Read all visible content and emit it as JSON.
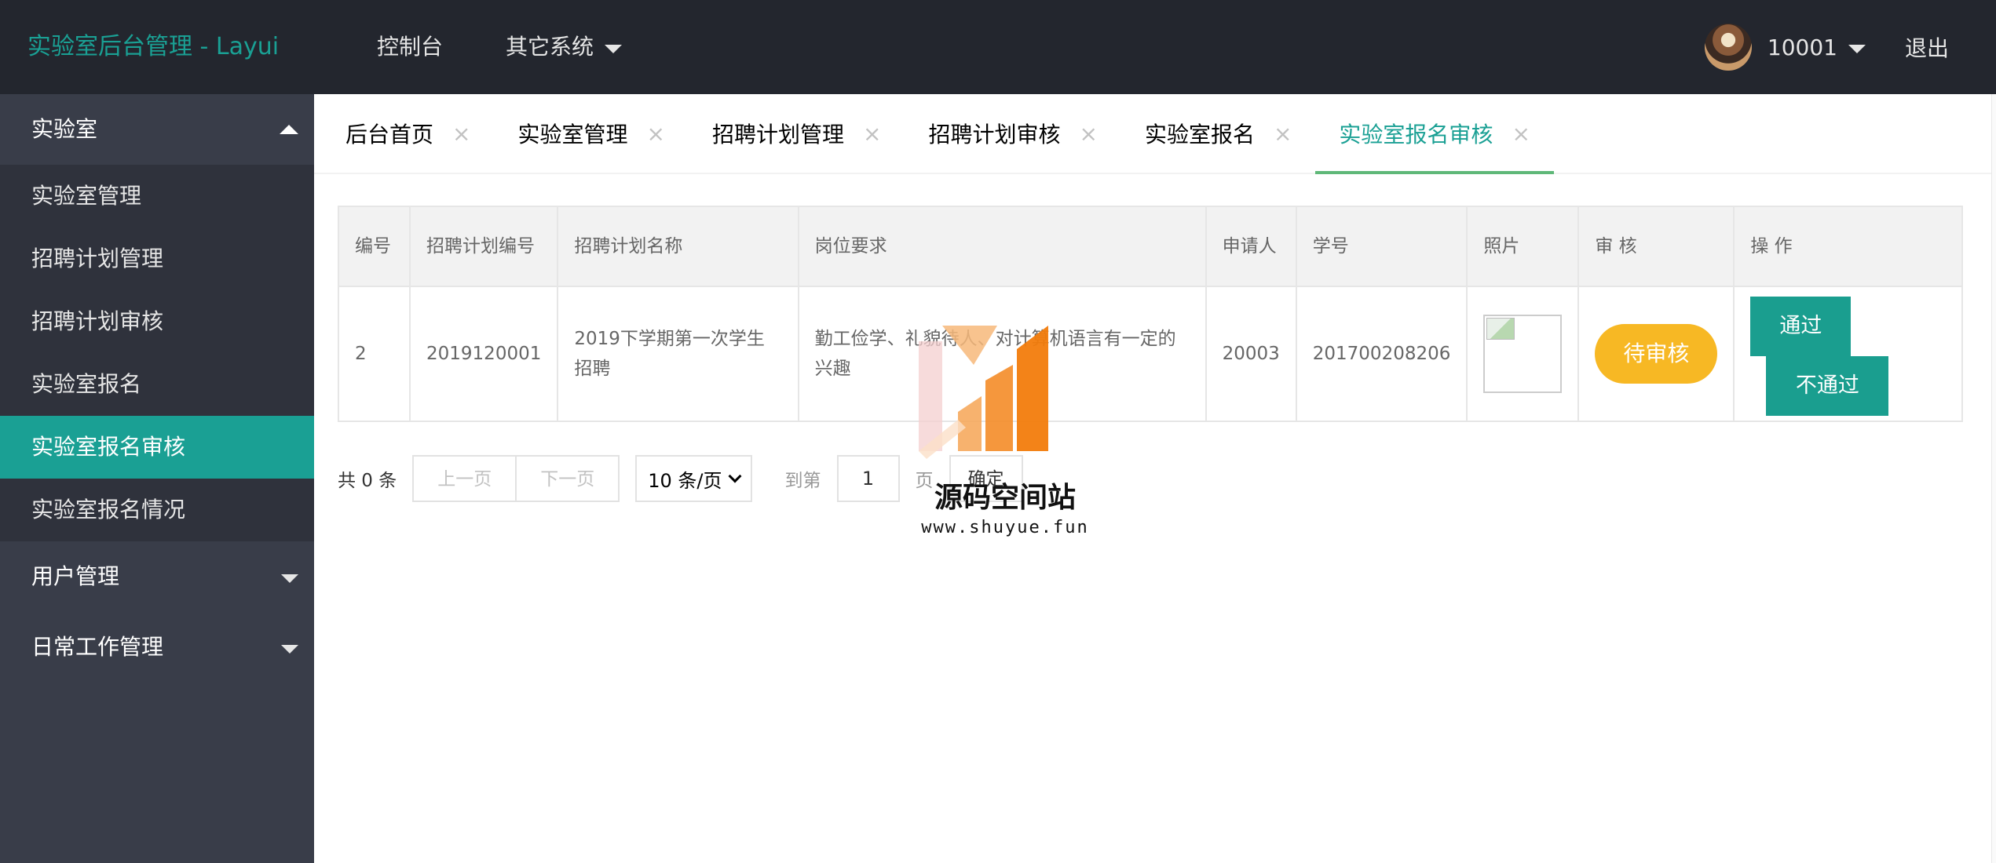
{
  "header": {
    "logo": "实验室后台管理 - Layui",
    "nav": [
      {
        "label": "控制台",
        "dropdown": false
      },
      {
        "label": "其它系统",
        "dropdown": true
      }
    ],
    "user": "10001",
    "logout": "退出"
  },
  "sidebar": {
    "groups": [
      {
        "label": "实验室",
        "open": true,
        "items": [
          "实验室管理",
          "招聘计划管理",
          "招聘计划审核",
          "实验室报名",
          "实验室报名审核",
          "实验室报名情况"
        ],
        "active": "实验室报名审核"
      },
      {
        "label": "用户管理",
        "open": false
      },
      {
        "label": "日常工作管理",
        "open": false
      }
    ]
  },
  "tabs": {
    "items": [
      "后台首页",
      "实验室管理",
      "招聘计划管理",
      "招聘计划审核",
      "实验室报名",
      "实验室报名审核"
    ],
    "active": "实验室报名审核",
    "close_glyph": "×"
  },
  "table": {
    "headers": [
      "编号",
      "招聘计划编号",
      "招聘计划名称",
      "岗位要求",
      "申请人",
      "学号",
      "照片",
      "审 核",
      "操 作"
    ],
    "rows": [
      {
        "id": "2",
        "plan_no": "2019120001",
        "plan_name": "2019下学期第一次学生招聘",
        "requirement": "勤工俭学、礼貌待人、对计算机语言有一定的兴趣",
        "applicant": "20003",
        "student_no": "201700208206",
        "status": "待审核",
        "pass": "通过",
        "fail": "不通过"
      }
    ]
  },
  "pager": {
    "count": "共 0 条",
    "prev": "上一页",
    "next": "下一页",
    "page_size": "10 条/页",
    "goto": "到第",
    "page_value": "1",
    "unit": "页",
    "ok": "确定"
  },
  "watermark": {
    "name": "源码空间站",
    "url": "www.shuyue.fun"
  },
  "colors": {
    "header_bg": "#23262e",
    "sidebar_bg": "#393d49",
    "accent": "#1aa094",
    "pending": "#f7b824"
  }
}
